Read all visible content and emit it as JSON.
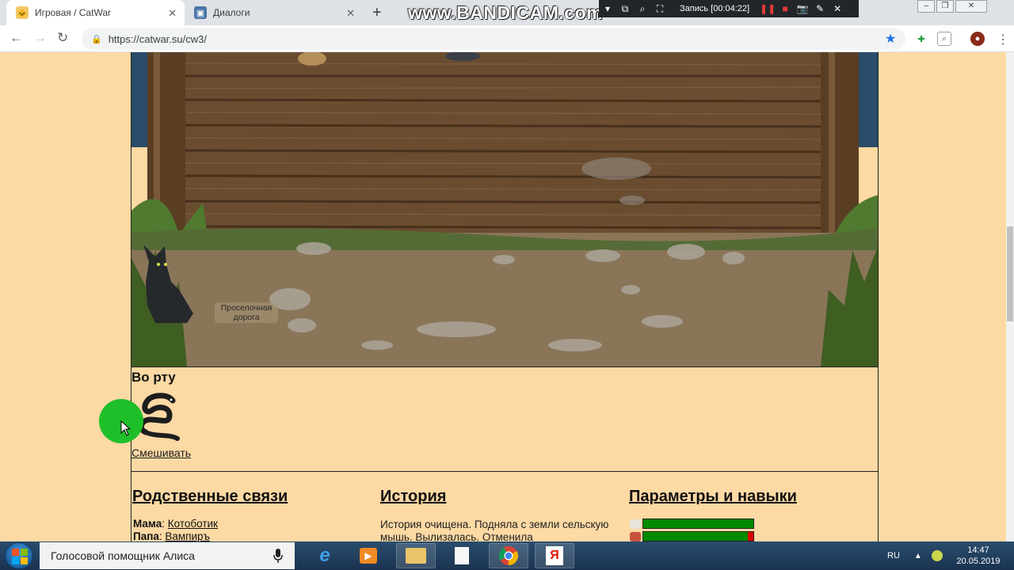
{
  "browser": {
    "tabs": [
      {
        "title": "Игровая / CatWar",
        "active": true
      },
      {
        "title": "Диалоги",
        "active": false
      }
    ],
    "url": "https://catwar.su/cw3/"
  },
  "recorder": {
    "watermark": "www.BANDICAM.com",
    "status": "Запись [00:04:22]"
  },
  "game": {
    "location_label": "Проселочная дорога",
    "mouth": {
      "title": "Во рту",
      "item_icon": "snake-icon",
      "action_link": "Смешивать"
    },
    "sections": {
      "relatives": {
        "title": "Родственные связи",
        "entries": [
          {
            "label": "Мама",
            "name": "Котоботик"
          },
          {
            "label": "Папа",
            "name": "Вампиръ"
          }
        ]
      },
      "history": {
        "title": "История",
        "text": "История очищена. Подняла с земли сельскую мышь. Вылизалась. Отменила"
      },
      "stats": {
        "title": "Параметры и навыки",
        "bars": [
          {
            "icon": "sleep-icon",
            "fill": 1.0
          },
          {
            "icon": "meat-icon",
            "fill": 0.95
          }
        ]
      }
    }
  },
  "taskbar": {
    "search_text": "Голосовой помощник Алиса",
    "apps": [
      "ie-icon",
      "media-player-icon",
      "explorer-icon",
      "file-icon",
      "chrome-icon",
      "yandex-icon"
    ],
    "language": "RU",
    "time": "14:47",
    "date": "20.05.2019"
  },
  "colors": {
    "page_bg": "#fdd9a4",
    "bar_green": "#008a00",
    "bar_red": "#e00000",
    "click_highlight": "#1fbf2a"
  }
}
